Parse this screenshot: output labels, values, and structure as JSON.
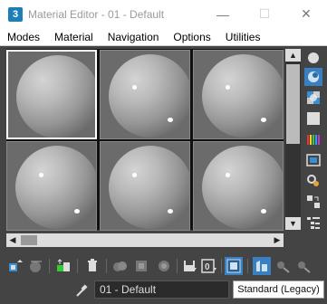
{
  "window": {
    "app_icon_text": "3",
    "title": "Material Editor - 01 - Default",
    "minimize": "—",
    "maximize": "☐",
    "close": "✕"
  },
  "menu": {
    "items": [
      {
        "label": "Modes"
      },
      {
        "label": "Material"
      },
      {
        "label": "Navigation"
      },
      {
        "label": "Options"
      },
      {
        "label": "Utilities"
      }
    ]
  },
  "slots": {
    "count": 6,
    "active_index": 0
  },
  "scrollbars": {
    "up": "▲",
    "down": "▼",
    "left": "◀",
    "right": "▶"
  },
  "right_toolbar": {
    "icons": [
      "sample-type-sphere-icon",
      "backlight-icon",
      "background-checker-icon",
      "sample-uv-tiling-icon",
      "video-color-check-icon",
      "make-preview-icon",
      "options-icon",
      "select-by-material-icon",
      "material-map-navigator-icon"
    ],
    "active": "backlight-icon"
  },
  "bottom_toolbar": {
    "icons": [
      "get-material-icon",
      "put-material-to-scene-icon",
      "assign-material-to-selection-icon",
      "reset-map-icon",
      "make-material-copy-icon",
      "make-unique-icon",
      "put-to-library-icon",
      "material-id-channel-icon",
      "show-shaded-material-icon",
      "show-end-result-icon",
      "go-to-parent-icon",
      "go-forward-to-sibling-icon"
    ],
    "material_id_label": "0",
    "active": [
      "show-shaded-material-icon",
      "show-end-result-icon"
    ]
  },
  "material": {
    "name": "01 - Default",
    "type": "Standard (Legacy)"
  },
  "colors": {
    "accent": "#3a7fbf",
    "panel_bg": "#444444",
    "titlebar_bg": "#ffffff",
    "app_icon_bg": "#1d7fb8"
  }
}
